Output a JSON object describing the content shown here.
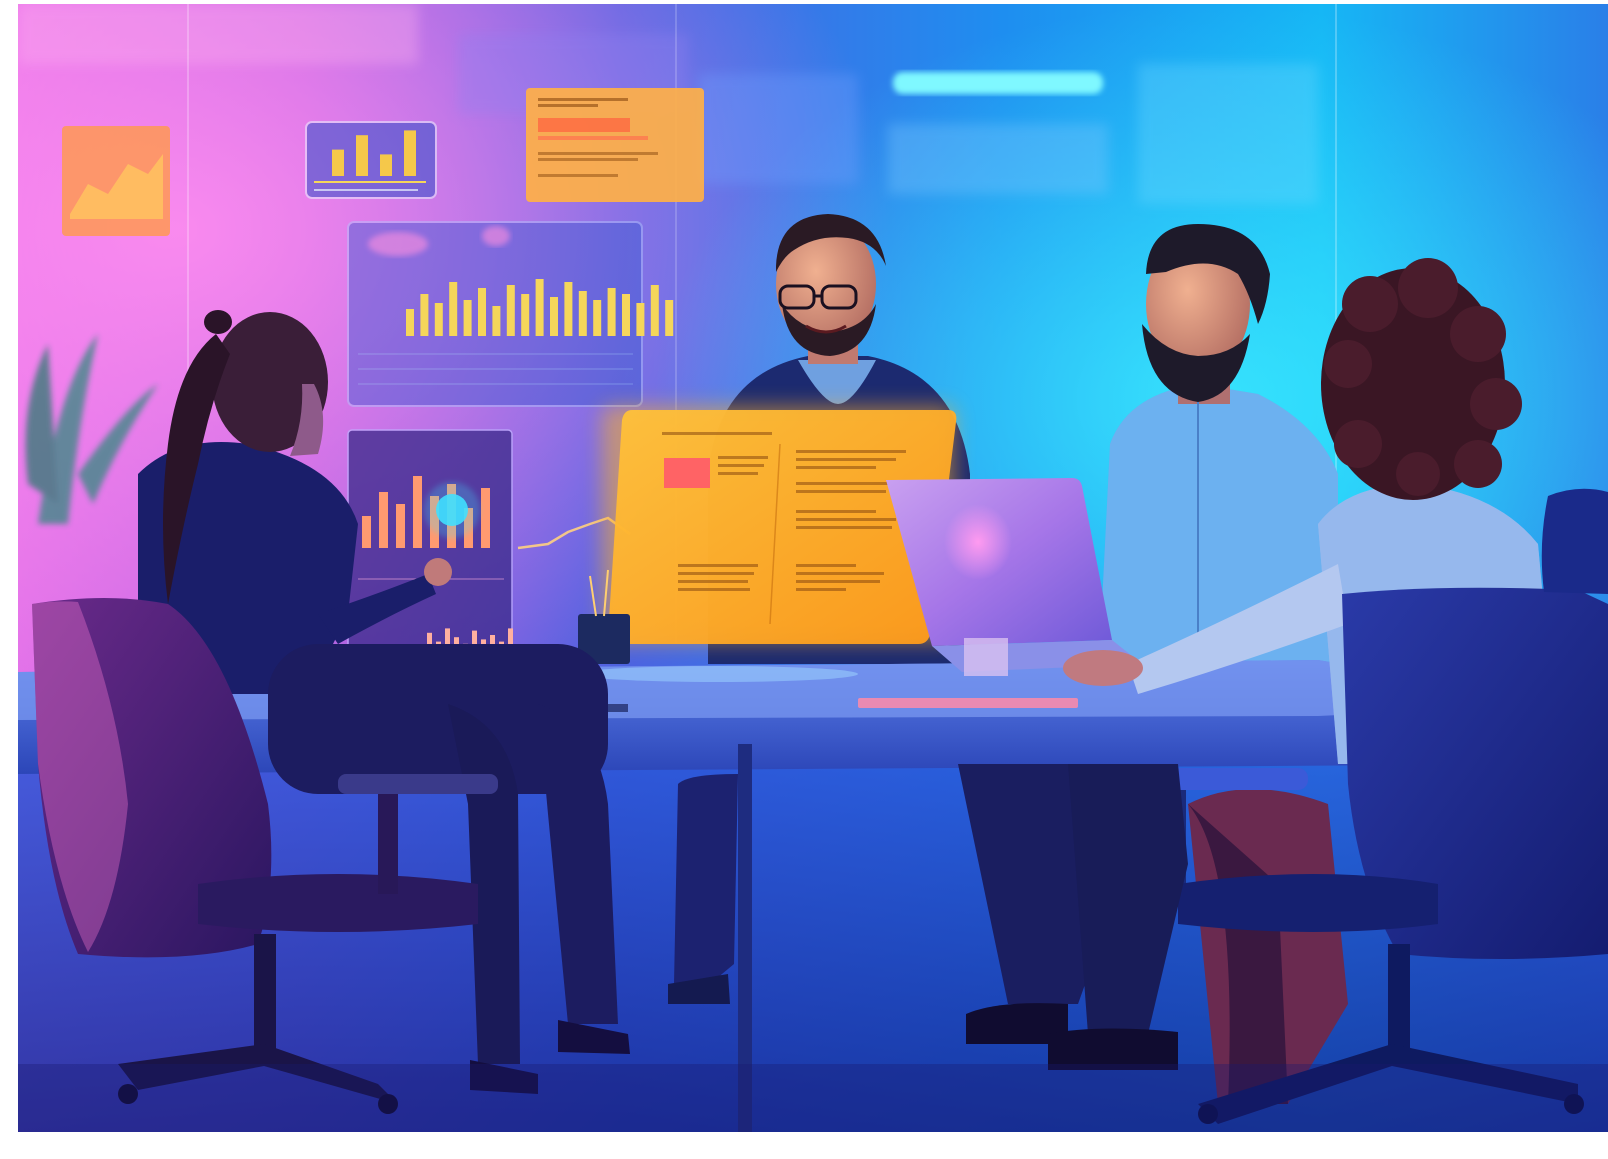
{
  "scene": {
    "subject": "team-meeting-with-holographic-dashboards",
    "colors": {
      "pink_glow": "#ff6fd8",
      "cyan_glow": "#00d7ff",
      "deep_blue": "#1a2a9e",
      "hologram_orange": "#ffb020",
      "hologram_yellow": "#f5d65a"
    },
    "holograms": {
      "top_left_bar_chart_values": [
        0.55,
        0.85,
        0.45,
        0.95
      ],
      "center_bar_chart_values": [
        0.45,
        0.7,
        0.55,
        0.9,
        0.6,
        0.8,
        0.5,
        0.85,
        0.7,
        0.95,
        0.65,
        0.9,
        0.75,
        0.6,
        0.8,
        0.7,
        0.55,
        0.85,
        0.6
      ],
      "left_panel_bar_values": [
        0.4,
        0.7,
        0.55,
        0.9,
        0.65,
        0.8,
        0.5,
        0.75
      ],
      "left_panel_small_bar_values": [
        0.5,
        0.8,
        0.6,
        0.9,
        0.7,
        0.55,
        0.85,
        0.65,
        0.75,
        0.6,
        0.9,
        0.5
      ]
    }
  }
}
